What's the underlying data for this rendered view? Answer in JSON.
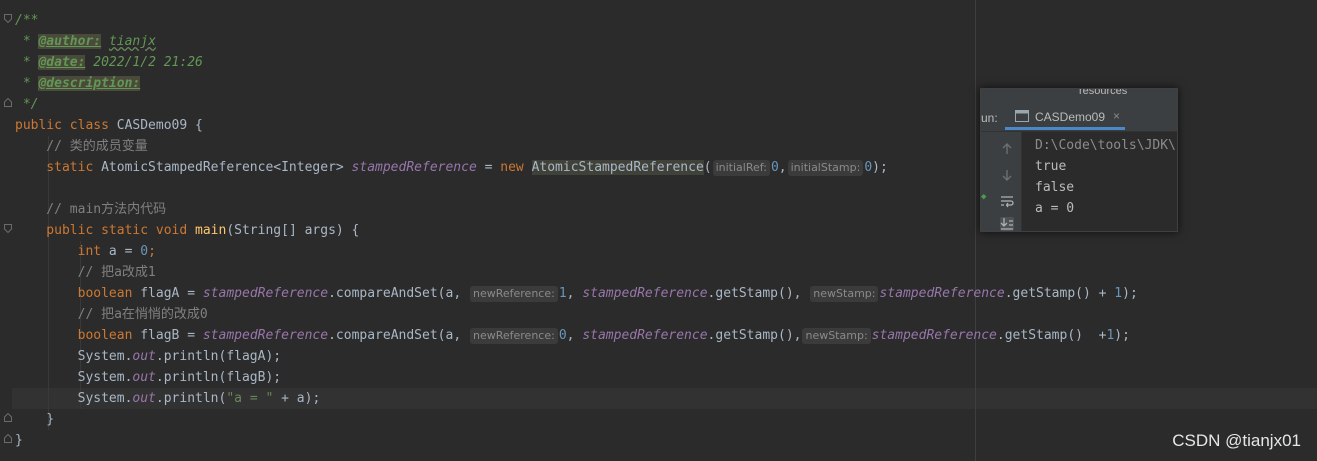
{
  "editor": {
    "lines": {
      "l1": "/**",
      "l2_prefix": " * ",
      "l2_tag": "@author:",
      "l2_value": "tianjx",
      "l3_prefix": " * ",
      "l3_tag": "@date:",
      "l3_value": " 2022/1/2 21:26",
      "l4_prefix": " * ",
      "l4_tag": "@description:",
      "l5": " */",
      "l6_kw": "public class ",
      "l6_name": "CASDemo09 {",
      "l7": "    // 类的成员变量",
      "l8_kw": "    static ",
      "l8_type": "AtomicStampedReference<Integer> ",
      "l8_field": "stampedReference",
      "l8_eq": " = ",
      "l8_new": "new ",
      "l8_ctor": "AtomicStampedReference",
      "l8_open": "(",
      "l8_hint1": "initialRef:",
      "l8_val1": "0",
      "l8_comma": ",",
      "l8_hint2": "initialStamp:",
      "l8_val2": "0",
      "l8_close": ");",
      "l10": "    // main方法内代码",
      "l11_kw": "    public static void ",
      "l11_fn": "main",
      "l11_rest": "(String[] args) {",
      "l12_kw": "        int ",
      "l12_rest": "a = ",
      "l12_num": "0",
      "l12_end": ";",
      "l13": "        // 把a改成1",
      "l14_kw": "        boolean ",
      "l14_var": "flagA = ",
      "l14_field": "stampedReference",
      "l14_call": ".compareAndSet(a, ",
      "l14_hint1": "newReference:",
      "l14_num": "1",
      "l14_sep": ", ",
      "l14_field2": "stampedReference",
      "l14_call2": ".getStamp(), ",
      "l14_hint2": "newStamp:",
      "l14_field3": "stampedReference",
      "l14_call3": ".getStamp() + ",
      "l14_num2": "1",
      "l14_end": ");",
      "l15": "        // 把a在悄悄的改成0",
      "l16_kw": "        boolean ",
      "l16_var": "flagB = ",
      "l16_field": "stampedReference",
      "l16_call": ".compareAndSet(a, ",
      "l16_hint1": "newReference:",
      "l16_num": "0",
      "l16_sep": ", ",
      "l16_field2": "stampedReference",
      "l16_call2": ".getStamp(),",
      "l16_hint2": "newStamp:",
      "l16_field3": "stampedReference",
      "l16_call3": ".getStamp()  +",
      "l16_num2": "1",
      "l16_end": ");",
      "l17_pre": "        System.",
      "l17_out": "out",
      "l17_post": ".println(flagA);",
      "l18_pre": "        System.",
      "l18_out": "out",
      "l18_post": ".println(flagB);",
      "l19_pre": "        System.",
      "l19_out": "out",
      "l19_call": ".println(",
      "l19_str": "\"a = \"",
      "l19_post": " + a);",
      "l20": "    }",
      "l21": "}"
    }
  },
  "run_panel": {
    "top_label": "resources",
    "run_label": "un:",
    "tab_label": "CASDemo09",
    "tab_close": "×",
    "output": [
      "D:\\Code\\tools\\JDK\\",
      "true",
      "false",
      "a = 0"
    ]
  },
  "watermark": "CSDN @tianjx01",
  "colors": {
    "background": "#2b2b2b",
    "keyword": "#cc7832",
    "comment": "#629755",
    "static_field": "#9876aa",
    "number": "#6897bb",
    "string": "#6a8759",
    "method": "#ffc66d",
    "tab_underline": "#4a88c7"
  },
  "icons": [
    "fold-icon",
    "up-arrow-icon",
    "down-arrow-icon",
    "soft-wrap-icon",
    "scroll-to-end-icon",
    "console-tab-icon"
  ]
}
